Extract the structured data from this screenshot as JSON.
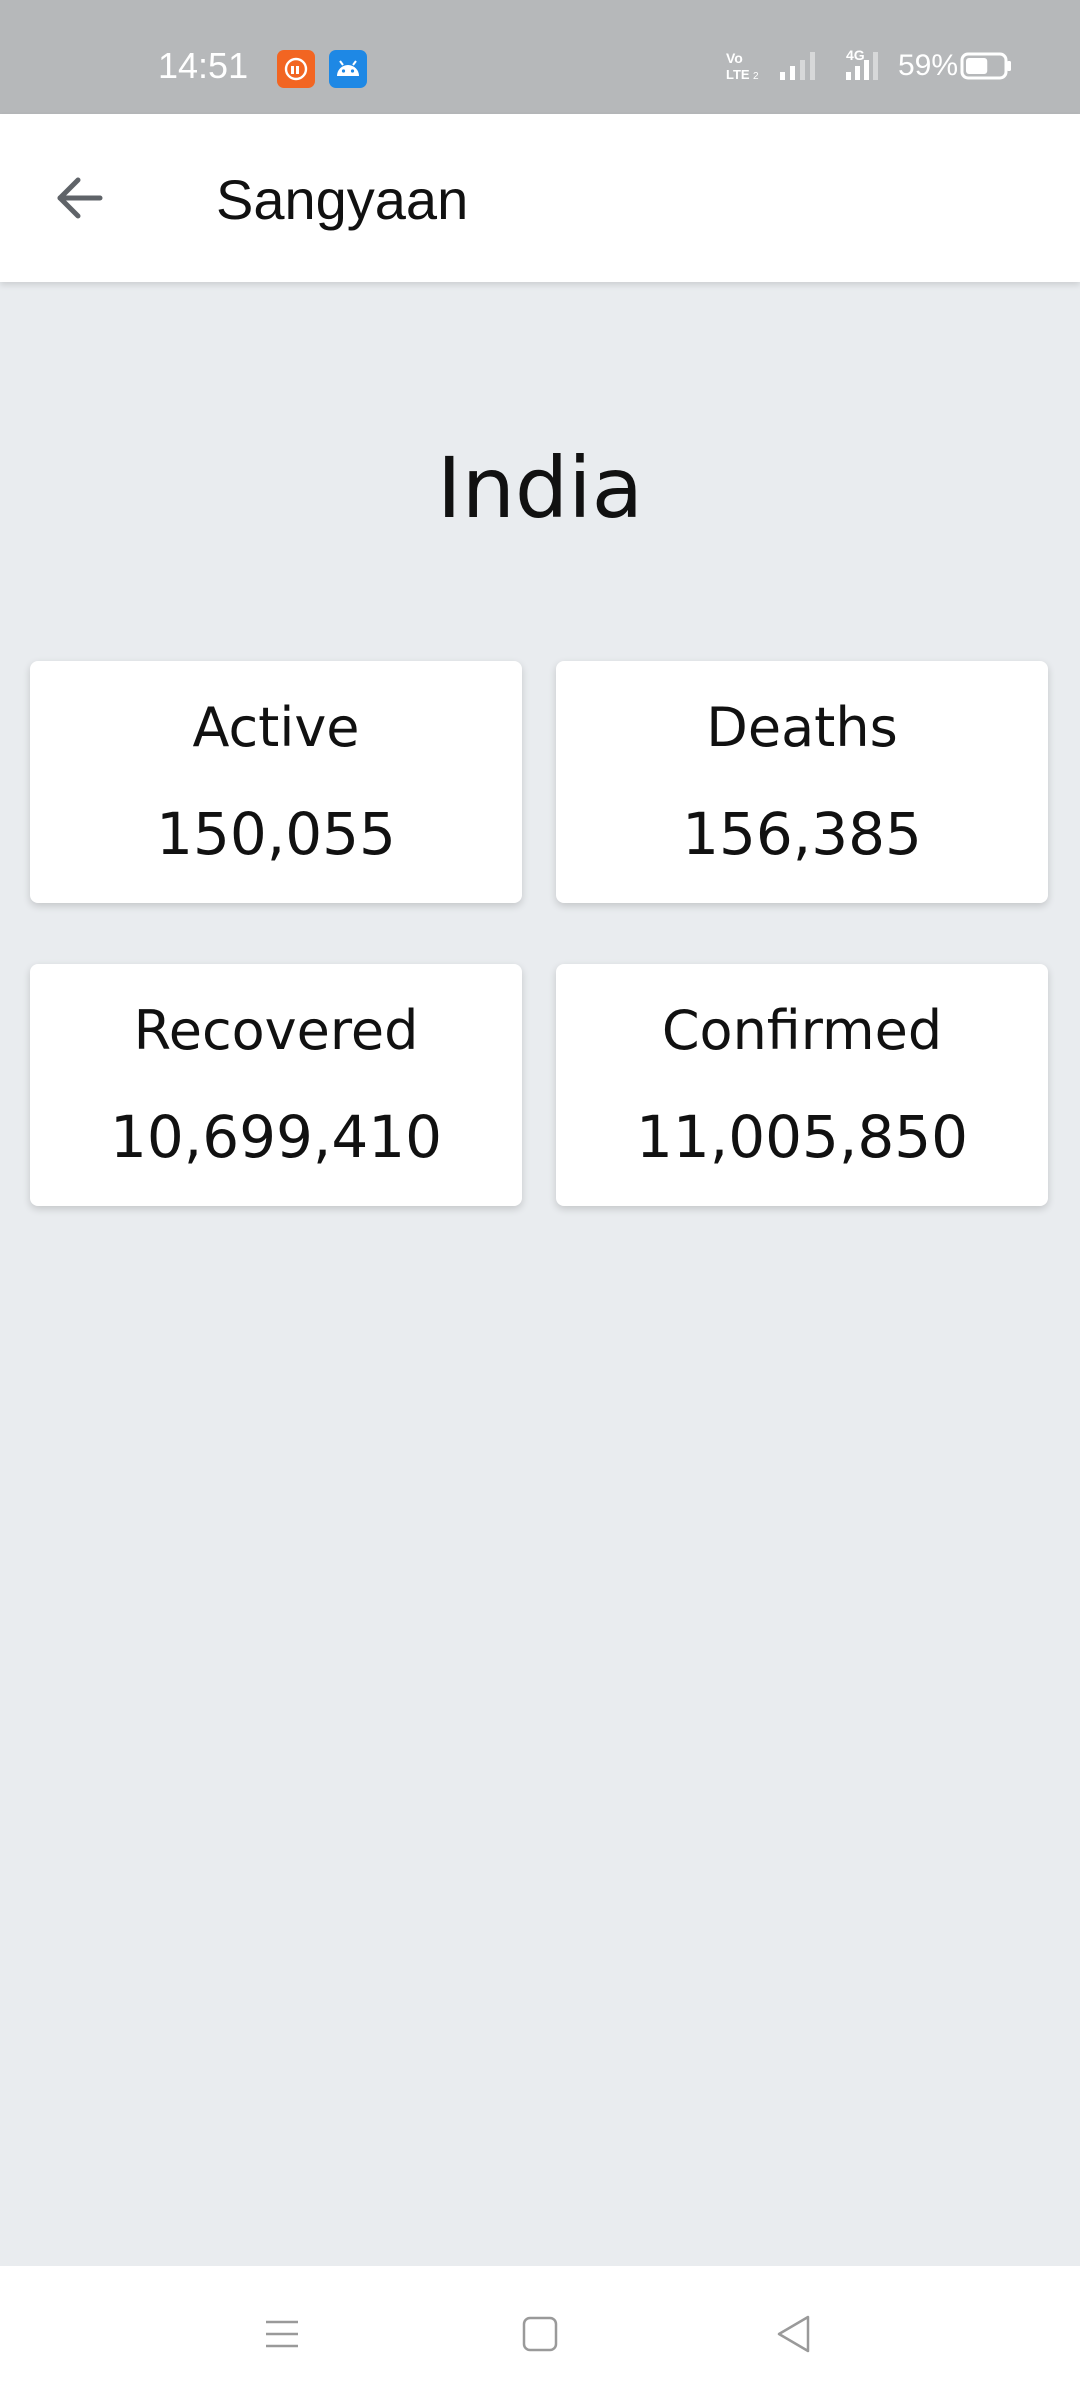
{
  "status_bar": {
    "time": "14:51",
    "battery_percent": "59%",
    "network_label": "4G",
    "volte_label": "Vo LTE",
    "icons": [
      "mi-notification-icon",
      "android-notification-icon",
      "volte-icon",
      "signal-icon",
      "signal-4g-icon",
      "battery-icon"
    ],
    "battery_level": 0.59
  },
  "app_bar": {
    "title": "Sangyaan",
    "back_icon": "arrow-left-icon"
  },
  "main": {
    "country": "India",
    "stats": [
      {
        "label": "Active",
        "value": "150,055"
      },
      {
        "label": "Deaths",
        "value": "156,385"
      },
      {
        "label": "Recovered",
        "value": "10,699,410"
      },
      {
        "label": "Confirmed",
        "value": "11,005,850"
      }
    ]
  },
  "nav_bar": {
    "icons": [
      "menu-icon",
      "home-icon",
      "back-triangle-icon"
    ]
  },
  "colors": {
    "status_bar": "#b6b8ba",
    "background": "#e9ecef",
    "card": "#ffffff",
    "text": "#111111",
    "mi_icon": "#f26522",
    "android_icon": "#1e88e5"
  }
}
